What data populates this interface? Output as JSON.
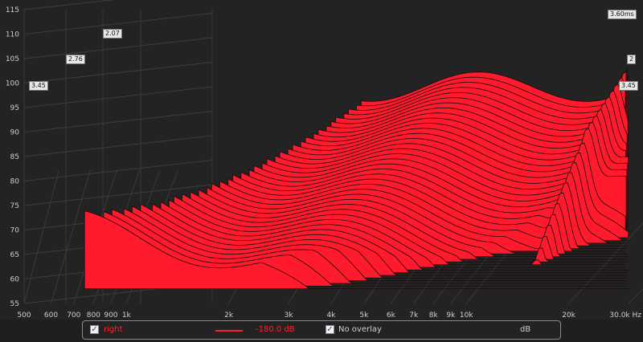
{
  "chart_data": {
    "type": "area",
    "title": "",
    "xlabel": "",
    "ylabel": "",
    "x_unit": "Hz",
    "x_scale": "log",
    "y_unit": "dB",
    "xlim": [
      500,
      30000
    ],
    "ylim": [
      55,
      115
    ],
    "x_ticks": [
      "500",
      "600",
      "700",
      "800",
      "900",
      "1k",
      "2k",
      "3k",
      "4k",
      "5k",
      "6k",
      "7k",
      "8k",
      "9k",
      "10k",
      "20k",
      "30.0k Hz"
    ],
    "y_ticks": [
      "55",
      "60",
      "65",
      "70",
      "75",
      "80",
      "85",
      "90",
      "95",
      "100",
      "105",
      "110",
      "115"
    ],
    "time_labels": [
      "2.07",
      "2.76",
      "3.45",
      "3.45",
      "2",
      "3.60ms"
    ],
    "grid": true,
    "series_color": "#ff1a2e"
  },
  "legend": {
    "channel_checked": "✓",
    "channel_label": "right",
    "channel_color": "#ff1a2e",
    "level_label": "-180.0 dB",
    "overlay_checked": "✓",
    "overlay_label": "No overlay",
    "unit_label": "dB"
  }
}
